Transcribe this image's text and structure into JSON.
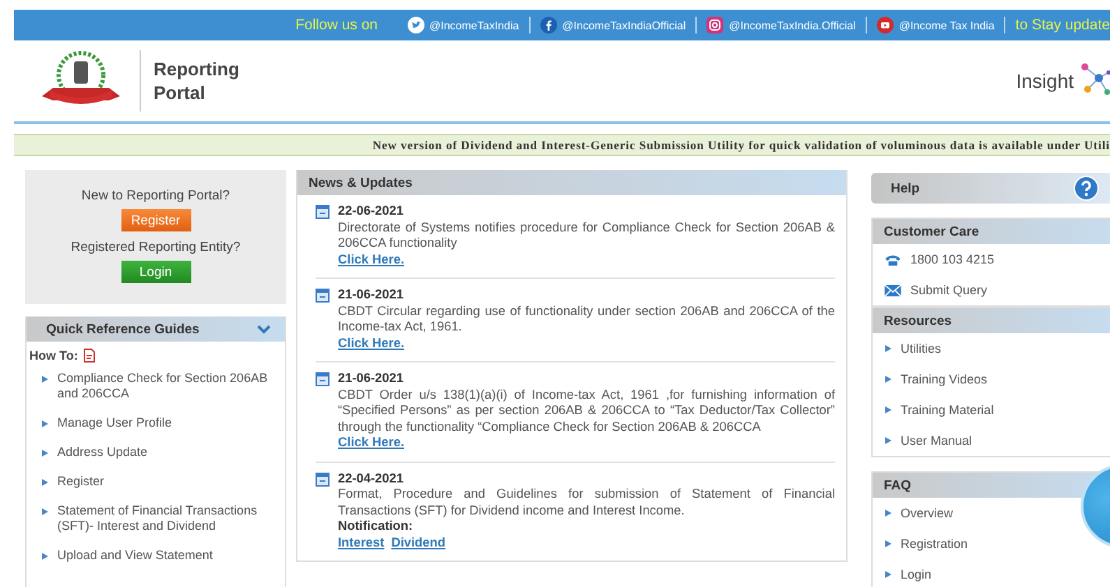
{
  "social_bar": {
    "lead": "Follow us on",
    "links": [
      {
        "kind": "twitter",
        "label": "@IncomeTaxIndia"
      },
      {
        "kind": "facebook",
        "label": "@IncomeTaxIndiaOfficial"
      },
      {
        "kind": "instagram",
        "label": "@IncomeTaxIndia.Official"
      },
      {
        "kind": "youtube",
        "label": "@Income Tax India"
      }
    ],
    "tail": "to Stay update"
  },
  "header": {
    "title_lines": [
      "Reporting",
      "Portal"
    ],
    "insight": "Insight"
  },
  "ticker": "New version of Dividend and Interest-Generic Submission Utility for quick validation of voluminous data is available under Utili",
  "account": {
    "new_prompt": "New to Reporting Portal?",
    "register": "Register",
    "registered_prompt": "Registered Reporting Entity?",
    "login": "Login"
  },
  "guides": {
    "title": "Quick Reference Guides",
    "expanded": true,
    "how_to": "How To:",
    "items": [
      "Compliance Check for Section 206AB and 206CCA",
      "Manage User Profile",
      "Address Update",
      "Register",
      "Statement of Financial Transactions (SFT)- Interest and Dividend",
      "Upload and View Statement"
    ]
  },
  "news": {
    "title": "News & Updates",
    "items": [
      {
        "date": "22-06-2021",
        "text": "Directorate of Systems notifies procedure for Compliance Check for Section 206AB & 206CCA functionality",
        "links": [
          "Click Here."
        ]
      },
      {
        "date": "21-06-2021",
        "text": "CBDT Circular regarding use of functionality under section 206AB and 206CCA of the Income-tax Act, 1961.",
        "links": [
          "Click Here."
        ]
      },
      {
        "date": "21-06-2021",
        "text": "CBDT Order u/s 138(1)(a)(i) of Income-tax Act, 1961 ,for furnishing information of “Specified Persons” as per section 206AB & 206CCA to “Tax Deductor/Tax Collector” through the functionality “Compliance Check for Section 206AB & 206CCA",
        "links": [
          "Click Here."
        ]
      },
      {
        "date": "22-04-2021",
        "text": "Format, Procedure and Guidelines for submission of Statement of Financial Transactions (SFT) for Dividend income and Interest Income.",
        "note": "Notification:",
        "links": [
          "Interest",
          "Dividend"
        ]
      }
    ]
  },
  "help": {
    "title": "Help"
  },
  "customer_care": {
    "title": "Customer Care",
    "items": [
      {
        "kind": "phone",
        "label": "1800 103 4215"
      },
      {
        "kind": "mail",
        "label": "Submit Query"
      }
    ]
  },
  "resources": {
    "title": "Resources",
    "items": [
      "Utilities",
      "Training Videos",
      "Training Material",
      "User Manual"
    ]
  },
  "faq": {
    "title": "FAQ",
    "items": [
      "Overview",
      "Registration",
      "Login"
    ]
  }
}
